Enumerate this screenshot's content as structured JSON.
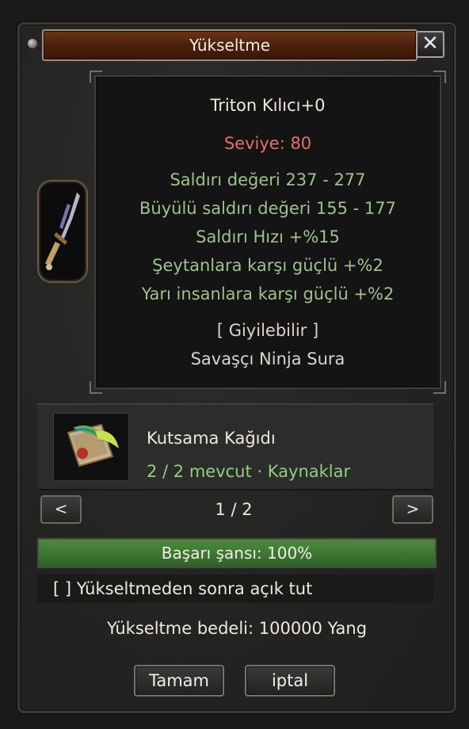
{
  "window": {
    "title": "Yükseltme",
    "close_label": "✕"
  },
  "tooltip": {
    "item_name": "Triton Kılıcı+0",
    "level": "Seviye: 80",
    "stats": [
      "Saldırı değeri 237 - 277",
      "Büyülü saldırı değeri 155 - 177",
      "Saldırı Hızı +%15",
      "Şeytanlara karşı güçlü +%2",
      "Yarı insanlara karşı güçlü +%2"
    ],
    "wearable": "[ Giyilebilir ]",
    "classes": "Savaşçı Ninja Sura"
  },
  "item_slot": {
    "icon": "sword-icon"
  },
  "material": {
    "icon": "blessing-scroll-icon",
    "name": "Kutsama Kağıdı",
    "count": "2 / 2 mevcut · Kaynaklar"
  },
  "pagination": {
    "prev_label": "<",
    "next_label": ">",
    "indicator": "1 / 2"
  },
  "success": {
    "label": "Başarı şansı: 100%",
    "percent": 100
  },
  "keep_open": {
    "label": "[ ] Yükseltmeden sonra açık tut"
  },
  "cost": {
    "label": "Yükseltme bedeli: 100000 Yang"
  },
  "buttons": {
    "ok_label": "Tamam",
    "cancel_label": "iptal"
  },
  "colors": {
    "title_bar": "#5a2810",
    "stat_green": "#9cc38c",
    "level_red": "#e2716a",
    "progress_green": "#3b7430"
  }
}
